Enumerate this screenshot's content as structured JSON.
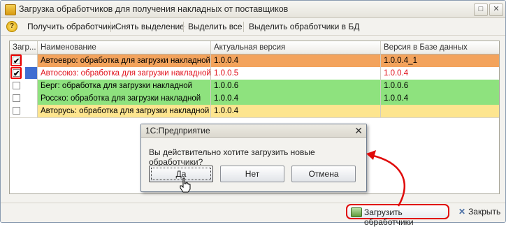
{
  "window": {
    "title": "Загрузка обработчиков для получения накладных от поставщиков",
    "buttons": [
      "□",
      "✕"
    ]
  },
  "toolbar": {
    "help": "?",
    "items": [
      "Получить обработчики",
      "Снять выделение",
      "Выделить все",
      "Выделить обработчики в БД"
    ]
  },
  "table": {
    "columns": [
      "Загр...",
      "Наименование",
      "Актуальная версия",
      "Версия в Базе данных"
    ],
    "rows": [
      {
        "checked": true,
        "name": "Автоевро: обработка для загрузки накладной",
        "actual": "1.0.0.4",
        "db": "1.0.0.4_1",
        "color": "#f3a35c",
        "text_color": "#000000"
      },
      {
        "checked": true,
        "name": "Автосоюз: обработка для загрузки накладной",
        "actual": "1.0.0.5",
        "db": "1.0.0.4",
        "color": "#ffffff",
        "text_color": "#e0101a"
      },
      {
        "checked": false,
        "name": "Берг: обработка для загрузки накладной",
        "actual": "1.0.0.6",
        "db": "1.0.0.6",
        "color": "#8ee27e",
        "text_color": "#000000"
      },
      {
        "checked": false,
        "name": "Росско: обработка для загрузки накладной",
        "actual": "1.0.0.4",
        "db": "1.0.0.4",
        "color": "#8ee27e",
        "text_color": "#000000"
      },
      {
        "checked": false,
        "name": "Авторусь: обработка для загрузки накладной",
        "actual": "1.0.0.4",
        "db": "",
        "color": "#fde58f",
        "text_color": "#000000"
      }
    ]
  },
  "dialog": {
    "title": "1С:Предприятие",
    "message": "Вы действительно хотите загрузить новые обработчики?",
    "buttons": [
      "Да",
      "Нет",
      "Отмена"
    ]
  },
  "footer": {
    "load_label": "Загрузить обработчики",
    "close_label": "Закрыть"
  },
  "colors": {
    "highlight": "#e00a0a",
    "selected_cell": "#3f6ed1"
  }
}
